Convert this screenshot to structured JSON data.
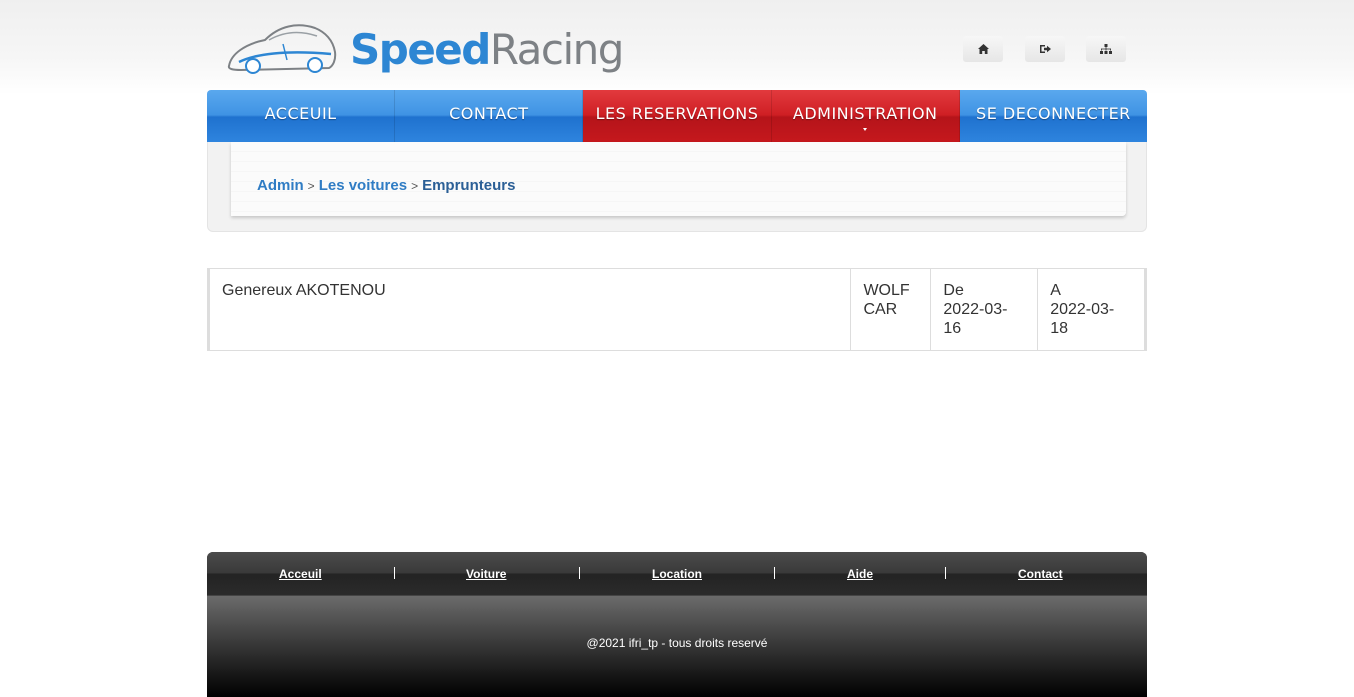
{
  "header": {
    "logo": {
      "brand_speed": "Speed",
      "brand_racing": "Racing",
      "icon": "car-outline-icon"
    },
    "top_icons": [
      {
        "name": "home-icon"
      },
      {
        "name": "sign-out-icon"
      },
      {
        "name": "sitemap-icon"
      }
    ]
  },
  "nav": {
    "items": [
      {
        "label": "ACCEUIL",
        "color": "#3f93e4"
      },
      {
        "label": "CONTACT",
        "color": "#3f93e4"
      },
      {
        "label": "LES RESERVATIONS",
        "color": "#cf1f24"
      },
      {
        "label": "ADMINISTRATION",
        "color": "#cf1f24",
        "has_submenu": true
      },
      {
        "label": "SE DECONNECTER",
        "color": "#3f93e4"
      }
    ]
  },
  "breadcrumb": {
    "items": [
      "Admin",
      "Les voitures",
      "Emprunteurs"
    ],
    "separator": ">"
  },
  "reservations": {
    "rows": [
      {
        "borrower": "Genereux AKOTENOU",
        "agency_line1": "WOLF",
        "agency_line2": "CAR",
        "from_label": "De",
        "from_date": "2022-03-16",
        "to_label": "A",
        "to_date": "2022-03-18"
      }
    ]
  },
  "footer": {
    "links": [
      "Acceuil",
      "Voiture",
      "Location",
      "Aide",
      "Contact"
    ],
    "copyright": "@2021 ifri_tp - tous droits reservé"
  },
  "colors": {
    "brand_blue": "#2d86d3",
    "brand_grey": "#7d8185",
    "nav_blue": "#3f93e4",
    "nav_red": "#cf1f24",
    "link": "#2f7cc4"
  }
}
